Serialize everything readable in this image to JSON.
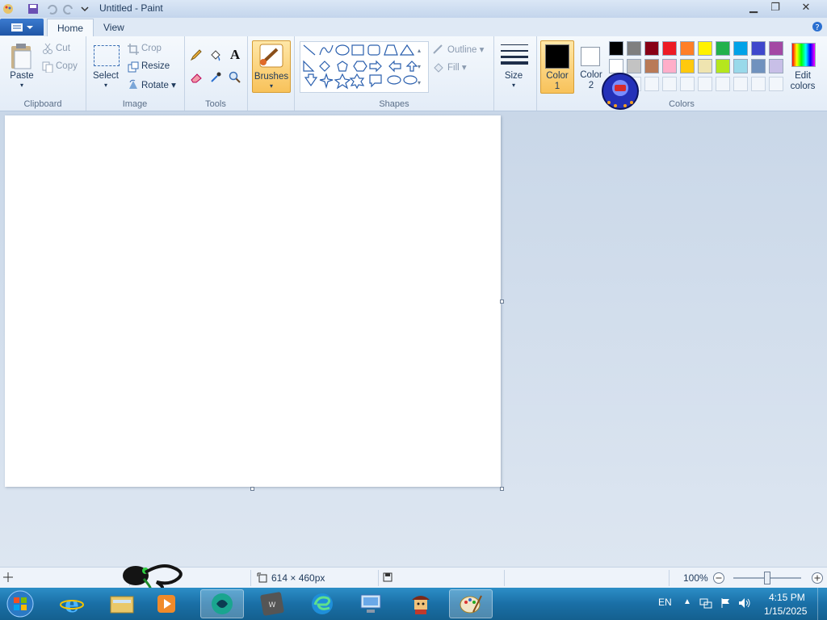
{
  "window": {
    "title": "Untitled - Paint"
  },
  "tabs": [
    {
      "label": "Home"
    },
    {
      "label": "View"
    }
  ],
  "clipboard": {
    "paste": "Paste",
    "cut": "Cut",
    "copy": "Copy",
    "group": "Clipboard"
  },
  "image": {
    "select": "Select",
    "crop": "Crop",
    "resize": "Resize",
    "rotate": "Rotate",
    "group": "Image"
  },
  "tools": {
    "group": "Tools"
  },
  "brushes": {
    "label": "Brushes"
  },
  "shapes": {
    "outline": "Outline",
    "fill": "Fill",
    "group": "Shapes"
  },
  "size": {
    "label": "Size"
  },
  "colors": {
    "color1": "Color",
    "color1_num": "1",
    "color2": "Color",
    "color2_num": "2",
    "edit": "Edit",
    "edit2": "colors",
    "group": "Colors",
    "row1": [
      "#000000",
      "#7f7f7f",
      "#880015",
      "#ed1c24",
      "#ff7f27",
      "#fff200",
      "#22b14c",
      "#00a2e8",
      "#3f48cc",
      "#a349a4"
    ],
    "row2": [
      "#ffffff",
      "#c3c3c3",
      "#b97a57",
      "#ffaec9",
      "#ffc90e",
      "#efe4b0",
      "#b5e61d",
      "#99d9ea",
      "#7092be",
      "#c8bfe7"
    ]
  },
  "status": {
    "dimensions": "614 × 460px",
    "zoom": "100%"
  },
  "taskbar": {
    "lang": "EN",
    "time": "4:15 PM",
    "date": "1/15/2025"
  }
}
